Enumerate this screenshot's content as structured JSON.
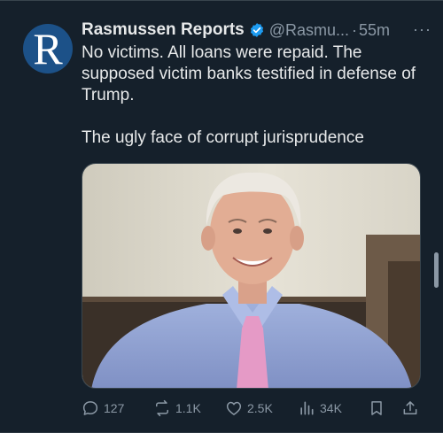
{
  "tweet": {
    "author_name": "Rasmussen Reports",
    "handle": "@Rasmu...",
    "separator": "·",
    "time": "55m",
    "avatar_letter": "R",
    "text": "No victims. All loans were repaid. The supposed victim banks testified in defense of Trump.\n\nThe ugly face of corrupt jurisprudence",
    "more_label": "···",
    "verified": true,
    "avatar_color": "#1c5188",
    "verified_color": "#1d9bf0"
  },
  "actions": {
    "replies": "127",
    "reposts": "1.1K",
    "likes": "2.5K",
    "views": "34K"
  },
  "icons": [
    "verified-badge-icon",
    "more-icon",
    "reply-icon",
    "repost-icon",
    "like-icon",
    "views-icon",
    "bookmark-icon",
    "share-icon"
  ]
}
